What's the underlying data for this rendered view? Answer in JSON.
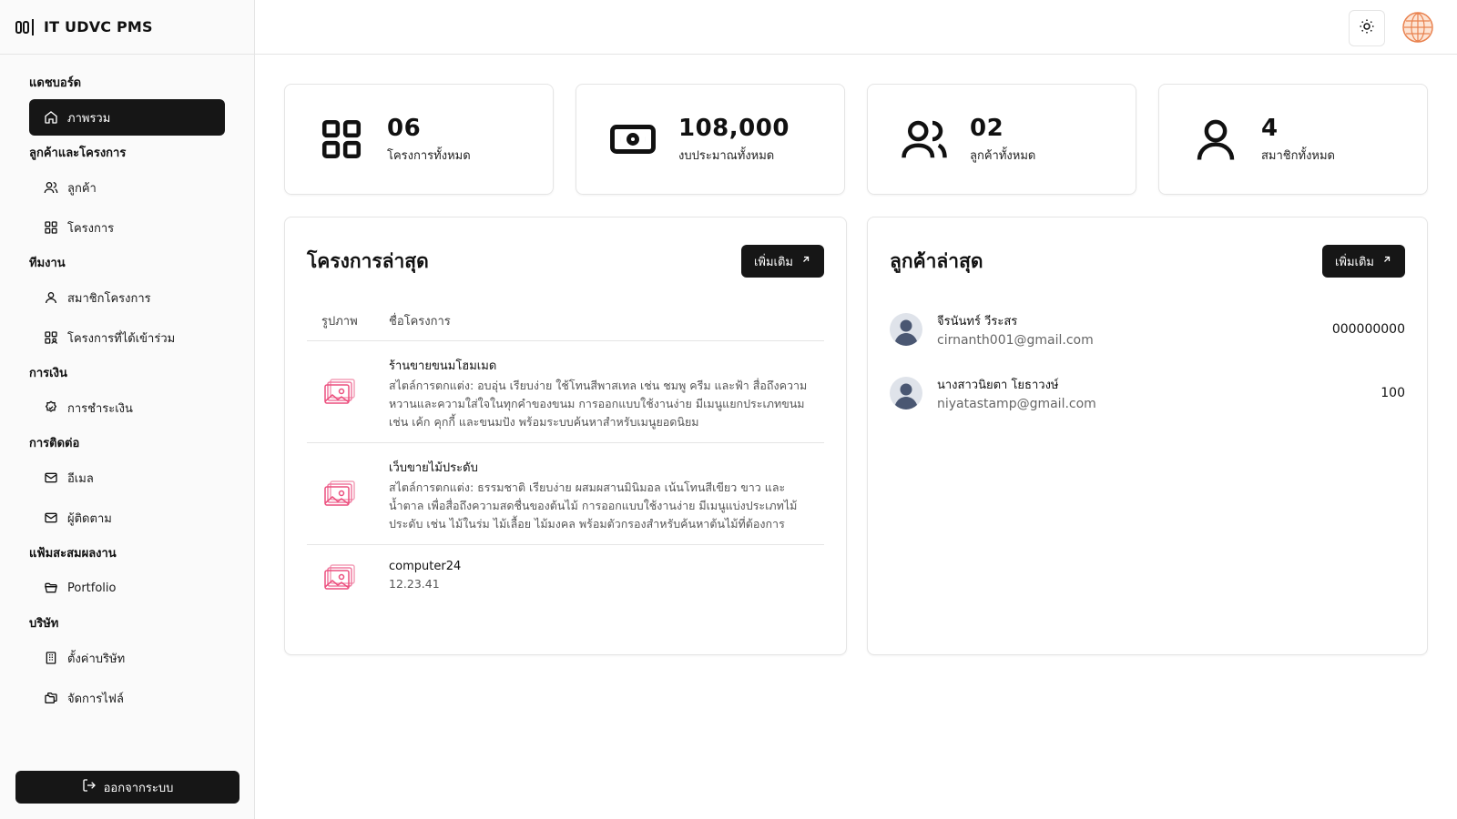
{
  "brand": {
    "title": "IT UDVC PMS",
    "logo_icon": "columns-icon"
  },
  "sidebar": {
    "groups": [
      {
        "title": "แดชบอร์ด",
        "items": [
          {
            "label": "ภาพรวม",
            "icon": "home-icon",
            "active": true
          }
        ]
      },
      {
        "title": "ลูกค้าและโครงการ",
        "items": [
          {
            "label": "ลูกค้า",
            "icon": "users-icon"
          },
          {
            "label": "โครงการ",
            "icon": "grid-icon"
          }
        ]
      },
      {
        "title": "ทีมงาน",
        "items": [
          {
            "label": "สมาชิกโครงการ",
            "icon": "user-icon"
          },
          {
            "label": "โครงการที่ได้เข้าร่วม",
            "icon": "grid-user-icon"
          }
        ]
      },
      {
        "title": "การเงิน",
        "items": [
          {
            "label": "การชำระเงิน",
            "icon": "badge-percent-icon"
          }
        ]
      },
      {
        "title": "การติดต่อ",
        "items": [
          {
            "label": "อีเมล",
            "icon": "mail-icon"
          },
          {
            "label": "ผู้ติดตาม",
            "icon": "mail-icon"
          }
        ]
      },
      {
        "title": "แฟ้มสะสมผลงาน",
        "items": [
          {
            "label": "Portfolio",
            "icon": "folder-open-icon"
          }
        ]
      },
      {
        "title": "บริษัท",
        "items": [
          {
            "label": "ตั้งค่าบริษัท",
            "icon": "building-icon"
          },
          {
            "label": "จัดการไฟล์",
            "icon": "folders-icon"
          }
        ]
      }
    ],
    "logout_label": "ออกจากระบบ"
  },
  "topbar": {
    "theme_icon": "sun-icon",
    "avatar_icon": "globe-icon"
  },
  "stats": [
    {
      "value": "06",
      "label": "โครงการทั้งหมด",
      "icon": "grid-icon"
    },
    {
      "value": "108,000",
      "label": "งบประมาณทั้งหมด",
      "icon": "banknote-icon"
    },
    {
      "value": "02",
      "label": "ลูกค้าทั้งหมด",
      "icon": "users-icon"
    },
    {
      "value": "4",
      "label": "สมาชิกทั้งหมด",
      "icon": "user-icon"
    }
  ],
  "projects_panel": {
    "title": "โครงการล่าสุด",
    "more_label": "เพิ่มเติม",
    "columns": [
      "รูปภาพ",
      "ชื่อโครงการ"
    ],
    "rows": [
      {
        "name": "ร้านขายขนมโฮมเมด",
        "desc": "สไตล์การตกแต่ง: อบอุ่น เรียบง่าย ใช้โทนสีพาสเทล เช่น ชมพู ครีม และฟ้า สื่อถึงความหวานและความใส่ใจในทุกคำของขนม การออกแบบใช้งานง่าย มีเมนูแยกประเภทขนม เช่น เค้ก คุกกี้ และขนมปัง พร้อมระบบค้นหาสำหรับเมนูยอดนิยม"
      },
      {
        "name": "เว็บขายไม้ประดับ",
        "desc": "สไตล์การตกแต่ง: ธรรมชาติ เรียบง่าย ผสมผสานมินิมอล เน้นโทนสีเขียว ขาว และน้ำตาล เพื่อสื่อถึงความสดชื่นของต้นไม้ การออกแบบใช้งานง่าย มีเมนูแบ่งประเภทไม้ประดับ เช่น ไม้ในร่ม ไม้เลื้อย ไม้มงคล พร้อมตัวกรองสำหรับค้นหาต้นไม้ที่ต้องการ"
      },
      {
        "name": "computer24",
        "desc": "12.23.41"
      }
    ]
  },
  "clients_panel": {
    "title": "ลูกค้าล่าสุด",
    "more_label": "เพิ่มเติม",
    "rows": [
      {
        "name": "จีรนันทร์ วีระสร",
        "email": "cirnanth001@gmail.com",
        "value": "000000000"
      },
      {
        "name": "นางสาวนิยตา โยธาวงษ์",
        "email": "niyatastamp@gmail.com",
        "value": "100"
      }
    ]
  }
}
